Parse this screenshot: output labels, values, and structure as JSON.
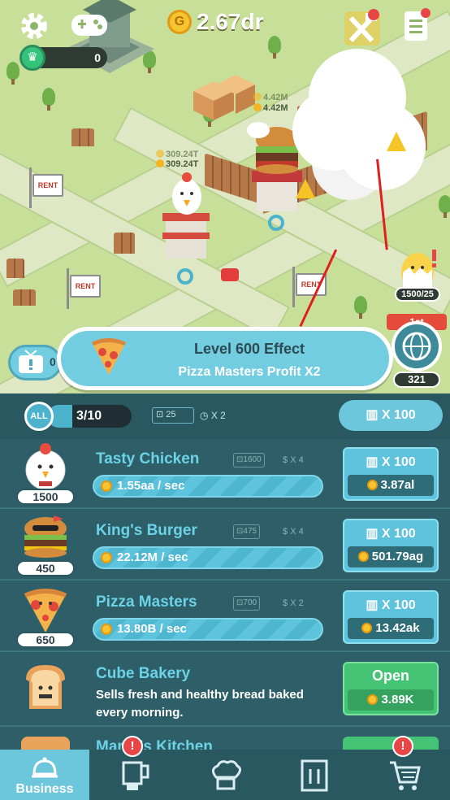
{
  "top_bar": {
    "coin_symbol": "G",
    "coin_amount": "2.67dr",
    "crown_count": "0",
    "icons": [
      "gear-icon",
      "gamepad-icon",
      "hammer-wrench-icon",
      "notepad-icon"
    ]
  },
  "map": {
    "rent_label": "RENT",
    "profit_labels": [
      "309.24T",
      "309.24T",
      "4.42M",
      "4.42M"
    ],
    "egg_count": "1500/25",
    "rank_ribbon": "1st",
    "rank_count": "321",
    "tv_count": "0"
  },
  "effect_banner": {
    "title": "Level 600 Effect",
    "subtitle": "Pizza Masters Profit X2"
  },
  "filter": {
    "all_label": "ALL",
    "progress_text": "3/10",
    "progress_fraction": 0.3,
    "lock_count": "25",
    "timer_mult": "X 2",
    "bulk_label": "X 100"
  },
  "businesses": [
    {
      "name": "Tasty Chicken",
      "level": "1500",
      "req": "1600",
      "mult": "X 4",
      "rate": "1.55aa / sec",
      "buy_label": "X 100",
      "cost": "3.87al"
    },
    {
      "name": "King's Burger",
      "level": "450",
      "req": "475",
      "mult": "X 4",
      "rate": "22.12M / sec",
      "buy_label": "X 100",
      "cost": "501.79ag"
    },
    {
      "name": "Pizza Masters",
      "level": "650",
      "req": "700",
      "mult": "X 2",
      "rate": "13.80B / sec",
      "buy_label": "X 100",
      "cost": "13.42ak"
    },
    {
      "name": "Cube Bakery",
      "description": "Sells fresh and healthy bread baked every morning.",
      "open_label": "Open",
      "cost": "3.89K"
    },
    {
      "name": "Mama's Kitchen"
    }
  ],
  "tabs": [
    {
      "label": "Business",
      "icon": "cloche-icon",
      "active": true
    },
    {
      "label": "",
      "icon": "blender-icon",
      "badge": "!"
    },
    {
      "label": "",
      "icon": "chef-hat-icon"
    },
    {
      "label": "",
      "icon": "menu-book-icon"
    },
    {
      "label": "",
      "icon": "cart-icon",
      "badge": "!"
    }
  ],
  "colors": {
    "accent": "#6cc7dd",
    "panel": "#2e5f68",
    "open_green": "#45c476",
    "coin": "#f7c431",
    "annotation_arrow": "#e01f1f"
  }
}
